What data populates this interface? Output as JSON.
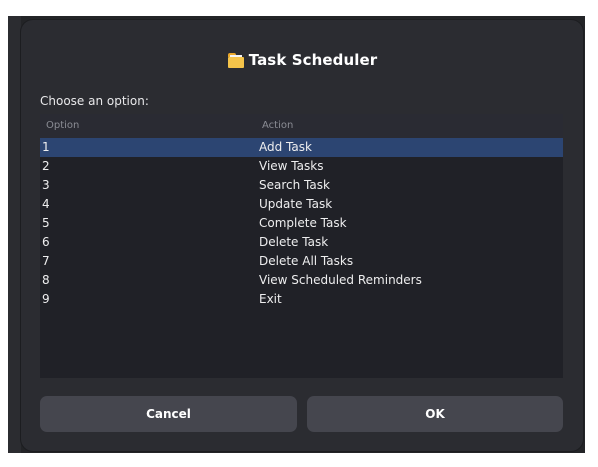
{
  "dialog": {
    "title": "Task Scheduler",
    "title_icon": "folder-icon",
    "prompt": "Choose an option:"
  },
  "list": {
    "headers": {
      "option": "Option",
      "action": "Action"
    },
    "selected_index": 0,
    "rows": [
      {
        "option": "1",
        "action": "Add Task"
      },
      {
        "option": "2",
        "action": "View Tasks"
      },
      {
        "option": "3",
        "action": "Search Task"
      },
      {
        "option": "4",
        "action": "Update Task"
      },
      {
        "option": "5",
        "action": "Complete Task"
      },
      {
        "option": "6",
        "action": "Delete Task"
      },
      {
        "option": "7",
        "action": "Delete All Tasks"
      },
      {
        "option": "8",
        "action": "View Scheduled Reminders"
      },
      {
        "option": "9",
        "action": "Exit"
      }
    ]
  },
  "buttons": {
    "cancel_label": "Cancel",
    "ok_label": "OK"
  },
  "colors": {
    "dialog_bg": "#2b2c31",
    "list_bg": "#202127",
    "selection": "#2c4572",
    "button_bg": "#45464e"
  }
}
